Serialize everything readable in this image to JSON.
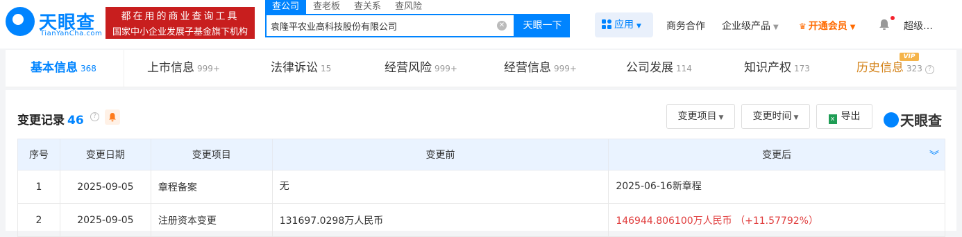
{
  "header": {
    "logo_cn": "天眼查",
    "logo_en": "TianYanCha.com",
    "slogan_line1": "都在用的商业查询工具",
    "slogan_line2": "国家中小企业发展子基金旗下机构",
    "search_tabs": [
      "查公司",
      "查老板",
      "查关系",
      "查风险"
    ],
    "search_value": "袁隆平农业高科技股份有限公司",
    "search_button": "天眼一下",
    "app_button": "应用",
    "nav": [
      "商务合作",
      "企业级产品",
      "开通会员"
    ],
    "username": "超级…"
  },
  "tabs": [
    {
      "label": "基本信息",
      "count": "368"
    },
    {
      "label": "上市信息",
      "count": "999+"
    },
    {
      "label": "法律诉讼",
      "count": "15"
    },
    {
      "label": "经营风险",
      "count": "999+"
    },
    {
      "label": "经营信息",
      "count": "999+"
    },
    {
      "label": "公司发展",
      "count": "114"
    },
    {
      "label": "知识产权",
      "count": "173"
    },
    {
      "label": "历史信息",
      "count": "323"
    }
  ],
  "vip_badge": "VIP",
  "section": {
    "title": "变更记录",
    "count": "46",
    "filter_item": "变更项目",
    "filter_time": "变更时间",
    "export": "导出",
    "brand": "天眼查"
  },
  "table": {
    "headers": [
      "序号",
      "变更日期",
      "变更项目",
      "变更前",
      "变更后"
    ],
    "rows": [
      {
        "no": "1",
        "date": "2025-09-05",
        "item": "章程备案",
        "before": "无",
        "after": "2025-06-16新章程"
      },
      {
        "no": "2",
        "date": "2025-09-05",
        "item": "注册资本变更",
        "before": "131697.0298万人民币",
        "after": "146944.806100万人民币 （+11.57792%）"
      }
    ]
  },
  "colors": {
    "brand_blue": "#0084ff",
    "red": "#e03c3c",
    "vip_orange": "#ff6a00"
  }
}
